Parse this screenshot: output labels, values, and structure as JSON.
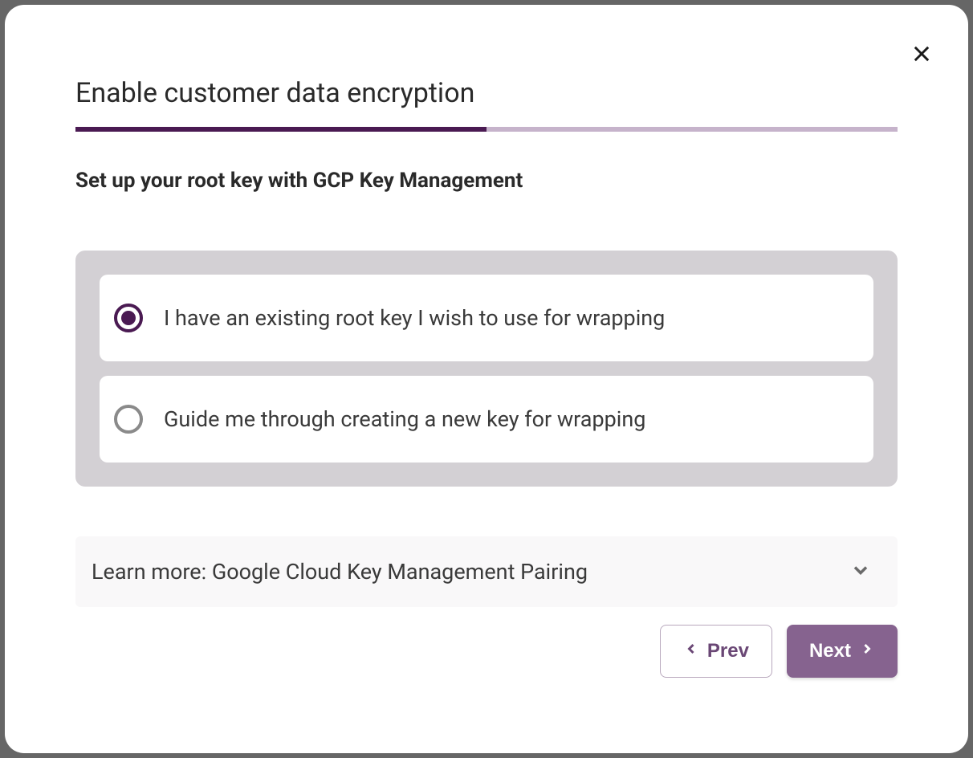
{
  "modal": {
    "title": "Enable customer data encryption",
    "progress_percent": 50,
    "section_heading": "Set up your root key with GCP Key Management",
    "options": [
      {
        "label": "I have an existing root key I wish to use for wrapping",
        "selected": true
      },
      {
        "label": "Guide me through creating a new key for wrapping",
        "selected": false
      }
    ],
    "learn_more_label": "Learn more: Google Cloud Key Management Pairing",
    "buttons": {
      "prev": "Prev",
      "next": "Next"
    }
  }
}
